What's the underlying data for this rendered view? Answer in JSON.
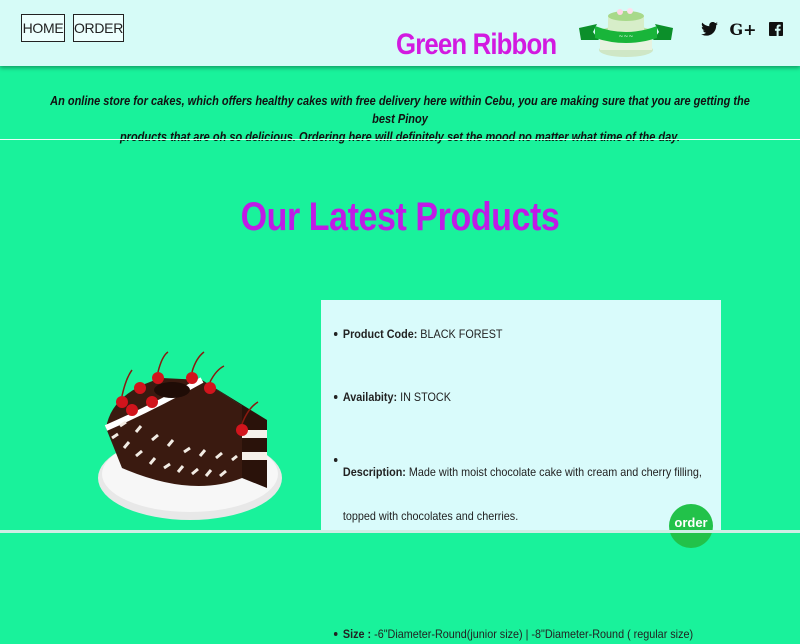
{
  "nav": {
    "home_label": "HOME",
    "order_label": "ORDER"
  },
  "brand": {
    "name": "Green Ribbon",
    "color": "#d21ae0"
  },
  "social": {
    "icons": [
      "twitter-icon",
      "google-plus-icon",
      "facebook-icon"
    ],
    "google_plus_text": "G+"
  },
  "tagline": {
    "line1": "An online store for cakes, which offers healthy cakes with free delivery here within Cebu, you are making sure that you are getting the best Pinoy",
    "line2": "products that are oh so delicious. Ordering here will definitely set the mood no matter what time of the day."
  },
  "section": {
    "title": "Our Latest Products",
    "title_color": "#c01ae6"
  },
  "product": {
    "code_label": "Product Code:",
    "code_value": " BLACK FOREST",
    "availability_label": "Availabity:",
    "availability_value": " IN STOCK",
    "description_label": "Description:",
    "description_value": " Made with moist chocolate cake with cream and cherry filling, topped with chocolates and cherries.",
    "size_label": "Size :",
    "size_value": " -6\"Diameter-Round(junior size) | -8\"Diameter-Round ( regular size)",
    "order_label": "order"
  },
  "colors": {
    "background": "#19f29b",
    "header": "#d6fbf7",
    "card": "#d9fbfb"
  }
}
